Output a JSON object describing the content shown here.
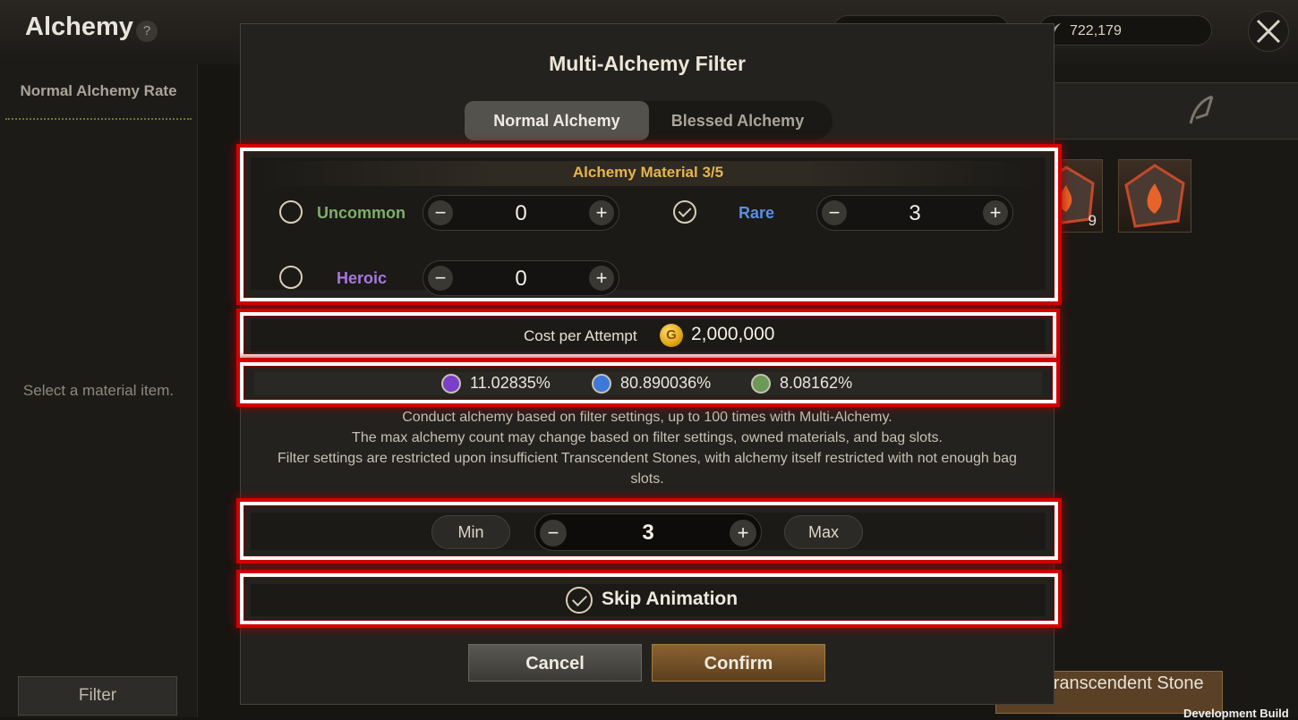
{
  "app": {
    "title": "Alchemy",
    "help": "?",
    "gold": "722,179"
  },
  "left": {
    "rate_title": "Normal Alchemy Rate",
    "select_hint": "Select a material item.",
    "filter_label": "Filter"
  },
  "right": {
    "slot_count": "9",
    "extract_label": "act Transcendent Stone"
  },
  "dev_build": "Development Build",
  "modal": {
    "title": "Multi-Alchemy Filter",
    "tabs": [
      {
        "label": "Normal Alchemy",
        "active": true
      },
      {
        "label": "Blessed Alchemy",
        "active": false
      }
    ],
    "material": {
      "title": "Alchemy Material 3/5",
      "grades": [
        {
          "name": "Uncommon",
          "checked": false,
          "value": "0",
          "color": "#7fae6a"
        },
        {
          "name": "Rare",
          "checked": true,
          "value": "3",
          "color": "#5b8ee0"
        },
        {
          "name": "Heroic",
          "checked": false,
          "value": "0",
          "color": "#a877e0"
        }
      ]
    },
    "cost": {
      "label": "Cost per Attempt",
      "coin": "G",
      "value": "2,000,000"
    },
    "rates": [
      {
        "value": "11.02835%",
        "color": "#7b3fc9"
      },
      {
        "value": "80.890036%",
        "color": "#3d7ad8"
      },
      {
        "value": "8.08162%",
        "color": "#6a9a55"
      }
    ],
    "description": [
      "Conduct alchemy based on filter settings, up to 100 times with Multi-Alchemy.",
      "The max alchemy count may change based on filter settings, owned materials, and bag slots.",
      "Filter settings are restricted upon insufficient Transcendent Stones, with alchemy itself restricted with not enough bag slots."
    ],
    "count": {
      "min_label": "Min",
      "value": "3",
      "max_label": "Max"
    },
    "skip": {
      "label": "Skip Animation",
      "checked": true
    },
    "buttons": {
      "cancel": "Cancel",
      "confirm": "Confirm"
    },
    "stepper_minus": "−",
    "stepper_plus": "+"
  }
}
